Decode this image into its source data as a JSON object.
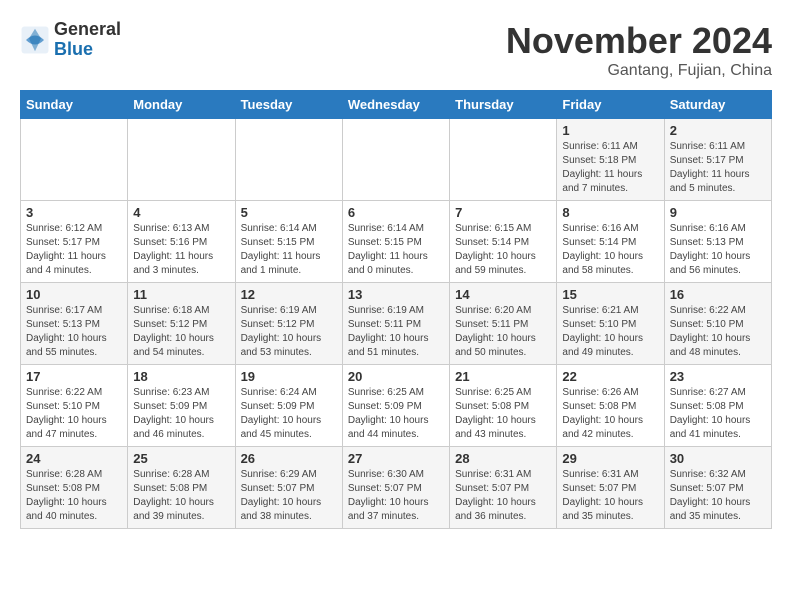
{
  "header": {
    "logo_general": "General",
    "logo_blue": "Blue",
    "month_title": "November 2024",
    "location": "Gantang, Fujian, China"
  },
  "days_of_week": [
    "Sunday",
    "Monday",
    "Tuesday",
    "Wednesday",
    "Thursday",
    "Friday",
    "Saturday"
  ],
  "weeks": [
    [
      {
        "day": "",
        "info": ""
      },
      {
        "day": "",
        "info": ""
      },
      {
        "day": "",
        "info": ""
      },
      {
        "day": "",
        "info": ""
      },
      {
        "day": "",
        "info": ""
      },
      {
        "day": "1",
        "info": "Sunrise: 6:11 AM\nSunset: 5:18 PM\nDaylight: 11 hours\nand 7 minutes."
      },
      {
        "day": "2",
        "info": "Sunrise: 6:11 AM\nSunset: 5:17 PM\nDaylight: 11 hours\nand 5 minutes."
      }
    ],
    [
      {
        "day": "3",
        "info": "Sunrise: 6:12 AM\nSunset: 5:17 PM\nDaylight: 11 hours\nand 4 minutes."
      },
      {
        "day": "4",
        "info": "Sunrise: 6:13 AM\nSunset: 5:16 PM\nDaylight: 11 hours\nand 3 minutes."
      },
      {
        "day": "5",
        "info": "Sunrise: 6:14 AM\nSunset: 5:15 PM\nDaylight: 11 hours\nand 1 minute."
      },
      {
        "day": "6",
        "info": "Sunrise: 6:14 AM\nSunset: 5:15 PM\nDaylight: 11 hours\nand 0 minutes."
      },
      {
        "day": "7",
        "info": "Sunrise: 6:15 AM\nSunset: 5:14 PM\nDaylight: 10 hours\nand 59 minutes."
      },
      {
        "day": "8",
        "info": "Sunrise: 6:16 AM\nSunset: 5:14 PM\nDaylight: 10 hours\nand 58 minutes."
      },
      {
        "day": "9",
        "info": "Sunrise: 6:16 AM\nSunset: 5:13 PM\nDaylight: 10 hours\nand 56 minutes."
      }
    ],
    [
      {
        "day": "10",
        "info": "Sunrise: 6:17 AM\nSunset: 5:13 PM\nDaylight: 10 hours\nand 55 minutes."
      },
      {
        "day": "11",
        "info": "Sunrise: 6:18 AM\nSunset: 5:12 PM\nDaylight: 10 hours\nand 54 minutes."
      },
      {
        "day": "12",
        "info": "Sunrise: 6:19 AM\nSunset: 5:12 PM\nDaylight: 10 hours\nand 53 minutes."
      },
      {
        "day": "13",
        "info": "Sunrise: 6:19 AM\nSunset: 5:11 PM\nDaylight: 10 hours\nand 51 minutes."
      },
      {
        "day": "14",
        "info": "Sunrise: 6:20 AM\nSunset: 5:11 PM\nDaylight: 10 hours\nand 50 minutes."
      },
      {
        "day": "15",
        "info": "Sunrise: 6:21 AM\nSunset: 5:10 PM\nDaylight: 10 hours\nand 49 minutes."
      },
      {
        "day": "16",
        "info": "Sunrise: 6:22 AM\nSunset: 5:10 PM\nDaylight: 10 hours\nand 48 minutes."
      }
    ],
    [
      {
        "day": "17",
        "info": "Sunrise: 6:22 AM\nSunset: 5:10 PM\nDaylight: 10 hours\nand 47 minutes."
      },
      {
        "day": "18",
        "info": "Sunrise: 6:23 AM\nSunset: 5:09 PM\nDaylight: 10 hours\nand 46 minutes."
      },
      {
        "day": "19",
        "info": "Sunrise: 6:24 AM\nSunset: 5:09 PM\nDaylight: 10 hours\nand 45 minutes."
      },
      {
        "day": "20",
        "info": "Sunrise: 6:25 AM\nSunset: 5:09 PM\nDaylight: 10 hours\nand 44 minutes."
      },
      {
        "day": "21",
        "info": "Sunrise: 6:25 AM\nSunset: 5:08 PM\nDaylight: 10 hours\nand 43 minutes."
      },
      {
        "day": "22",
        "info": "Sunrise: 6:26 AM\nSunset: 5:08 PM\nDaylight: 10 hours\nand 42 minutes."
      },
      {
        "day": "23",
        "info": "Sunrise: 6:27 AM\nSunset: 5:08 PM\nDaylight: 10 hours\nand 41 minutes."
      }
    ],
    [
      {
        "day": "24",
        "info": "Sunrise: 6:28 AM\nSunset: 5:08 PM\nDaylight: 10 hours\nand 40 minutes."
      },
      {
        "day": "25",
        "info": "Sunrise: 6:28 AM\nSunset: 5:08 PM\nDaylight: 10 hours\nand 39 minutes."
      },
      {
        "day": "26",
        "info": "Sunrise: 6:29 AM\nSunset: 5:07 PM\nDaylight: 10 hours\nand 38 minutes."
      },
      {
        "day": "27",
        "info": "Sunrise: 6:30 AM\nSunset: 5:07 PM\nDaylight: 10 hours\nand 37 minutes."
      },
      {
        "day": "28",
        "info": "Sunrise: 6:31 AM\nSunset: 5:07 PM\nDaylight: 10 hours\nand 36 minutes."
      },
      {
        "day": "29",
        "info": "Sunrise: 6:31 AM\nSunset: 5:07 PM\nDaylight: 10 hours\nand 35 minutes."
      },
      {
        "day": "30",
        "info": "Sunrise: 6:32 AM\nSunset: 5:07 PM\nDaylight: 10 hours\nand 35 minutes."
      }
    ]
  ]
}
